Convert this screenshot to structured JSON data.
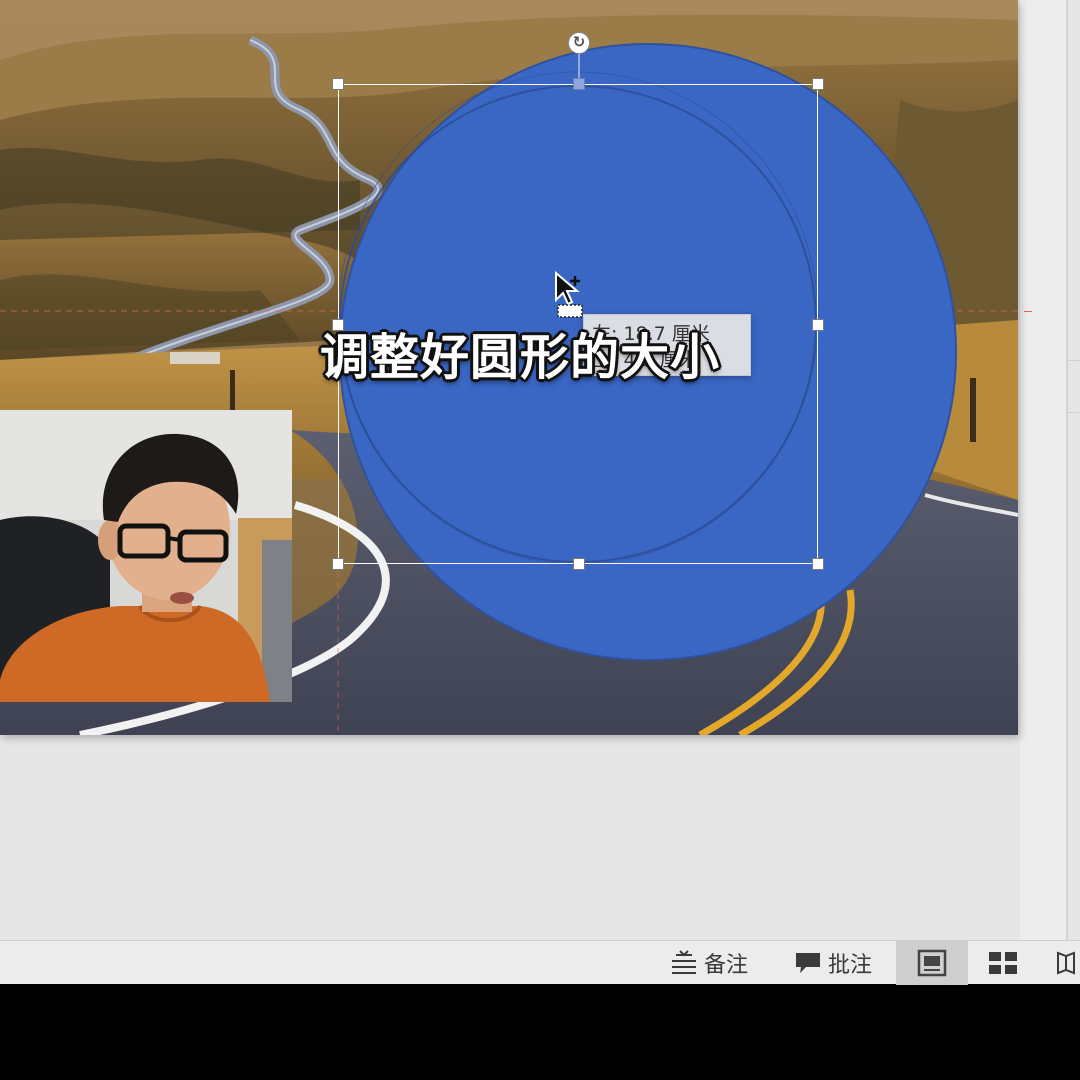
{
  "caption": {
    "subtitle": "调整好圆形的大小"
  },
  "size_tooltip": {
    "line1": "左: 18.7 厘米",
    "line2": "上: 4.5 厘米"
  },
  "status_bar": {
    "notes_label": "备注",
    "comments_label": "批注",
    "active_view": "normal"
  },
  "icons": {
    "notes": "notes-icon",
    "comments": "comment-bubble-icon",
    "view_normal": "normal-view-icon",
    "view_sorter": "slide-sorter-icon",
    "view_reading": "reading-view-icon",
    "rotate": "rotate-handle-icon",
    "cursor": "move-cursor-icon"
  },
  "colors": {
    "shape_fill": "#3a66c4",
    "selection_frame": "#ffffff",
    "workspace_bg": "#e6e6e6",
    "status_bar_bg": "#ececec"
  }
}
